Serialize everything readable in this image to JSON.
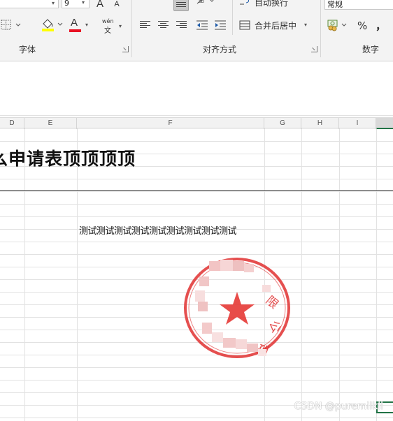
{
  "ribbon": {
    "font_size_value": "9",
    "font_group_label": "字体",
    "align_group_label": "对齐方式",
    "number_group_label": "数字",
    "wrap_text_label": "自动换行",
    "merge_center_label": "合并后居中",
    "number_format_value": "常规",
    "percent_symbol": "%",
    "comma_symbol": "，",
    "phonetic_top": "wén",
    "phonetic_bottom": "文",
    "grow_font_glyph": "A",
    "shrink_font_glyph": "A",
    "font_color_glyph": "A",
    "font_color": "#e81123",
    "fill_color": "#ffff00"
  },
  "sheet": {
    "columns": [
      "D",
      "E",
      "F",
      "G",
      "H",
      "I"
    ],
    "title": "么申请表顶顶顶顶",
    "content_text": "测试测试测试测试测试测试测试测试测试",
    "stamp_text": "限公司",
    "accent_color": "#217346"
  },
  "watermark": "CSDN @puremilkll"
}
